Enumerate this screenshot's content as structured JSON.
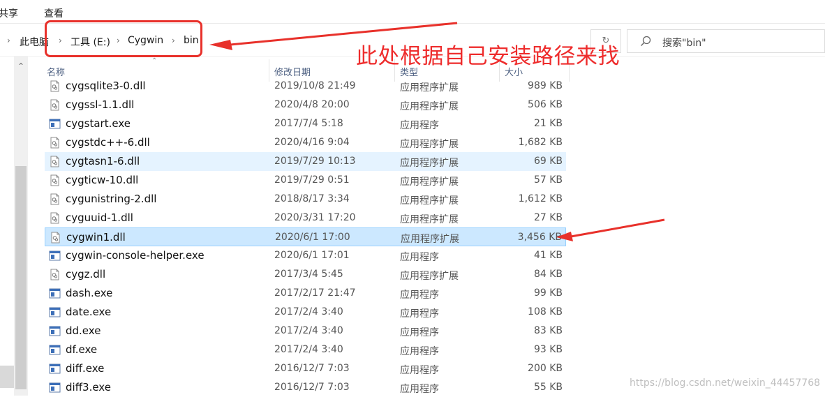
{
  "ribbon": {
    "tabs": [
      "共享",
      "查看"
    ]
  },
  "address": {
    "crumbs": [
      "此电脑",
      "工具 (E:)",
      "Cygwin",
      "bin"
    ],
    "search_placeholder": "搜索\"bin\""
  },
  "annotation": {
    "text": "此处根据自己安装路径来找",
    "color": "#ee2c2c"
  },
  "columns": {
    "name": "名称",
    "modified": "修改日期",
    "type": "类型",
    "size": "大小"
  },
  "files": [
    {
      "name": "cygsqlite3-0.dll",
      "date": "2019/10/8 21:49",
      "type": "应用程序扩展",
      "size": "989 KB",
      "icon": "dll-file-icon",
      "state": "normal"
    },
    {
      "name": "cygssl-1.1.dll",
      "date": "2020/4/8 20:00",
      "type": "应用程序扩展",
      "size": "506 KB",
      "icon": "dll-file-icon",
      "state": "normal"
    },
    {
      "name": "cygstart.exe",
      "date": "2017/7/4 5:18",
      "type": "应用程序",
      "size": "21 KB",
      "icon": "exe-file-icon",
      "state": "normal"
    },
    {
      "name": "cygstdc++-6.dll",
      "date": "2020/4/16 9:04",
      "type": "应用程序扩展",
      "size": "1,682 KB",
      "icon": "dll-file-icon",
      "state": "normal"
    },
    {
      "name": "cygtasn1-6.dll",
      "date": "2019/7/29 10:13",
      "type": "应用程序扩展",
      "size": "69 KB",
      "icon": "dll-file-icon",
      "state": "hover"
    },
    {
      "name": "cygticw-10.dll",
      "date": "2019/7/29 0:51",
      "type": "应用程序扩展",
      "size": "57 KB",
      "icon": "dll-file-icon",
      "state": "normal"
    },
    {
      "name": "cygunistring-2.dll",
      "date": "2018/8/17 3:34",
      "type": "应用程序扩展",
      "size": "1,612 KB",
      "icon": "dll-file-icon",
      "state": "normal"
    },
    {
      "name": "cyguuid-1.dll",
      "date": "2020/3/31 17:20",
      "type": "应用程序扩展",
      "size": "27 KB",
      "icon": "dll-file-icon",
      "state": "normal"
    },
    {
      "name": "cygwin1.dll",
      "date": "2020/6/1 17:00",
      "type": "应用程序扩展",
      "size": "3,456 KB",
      "icon": "dll-file-icon",
      "state": "selected"
    },
    {
      "name": "cygwin-console-helper.exe",
      "date": "2020/6/1 17:01",
      "type": "应用程序",
      "size": "41 KB",
      "icon": "exe-file-icon",
      "state": "normal"
    },
    {
      "name": "cygz.dll",
      "date": "2017/3/4 5:45",
      "type": "应用程序扩展",
      "size": "84 KB",
      "icon": "dll-file-icon",
      "state": "normal"
    },
    {
      "name": "dash.exe",
      "date": "2017/2/17 21:47",
      "type": "应用程序",
      "size": "99 KB",
      "icon": "exe-file-icon",
      "state": "normal"
    },
    {
      "name": "date.exe",
      "date": "2017/2/4 3:40",
      "type": "应用程序",
      "size": "108 KB",
      "icon": "exe-file-icon",
      "state": "normal"
    },
    {
      "name": "dd.exe",
      "date": "2017/2/4 3:40",
      "type": "应用程序",
      "size": "83 KB",
      "icon": "exe-file-icon",
      "state": "normal"
    },
    {
      "name": "df.exe",
      "date": "2017/2/4 3:40",
      "type": "应用程序",
      "size": "93 KB",
      "icon": "exe-file-icon",
      "state": "normal"
    },
    {
      "name": "diff.exe",
      "date": "2016/12/7 7:03",
      "type": "应用程序",
      "size": "200 KB",
      "icon": "exe-file-icon",
      "state": "normal"
    },
    {
      "name": "diff3.exe",
      "date": "2016/12/7 7:03",
      "type": "应用程序",
      "size": "55 KB",
      "icon": "exe-file-icon",
      "state": "normal"
    }
  ],
  "watermark": "https://blog.csdn.net/weixin_44457768",
  "colors": {
    "selected_row": "#cce8ff",
    "hover_row": "#e5f3ff",
    "annotation_red": "#ee2c2c",
    "header_text": "#4d6082"
  }
}
